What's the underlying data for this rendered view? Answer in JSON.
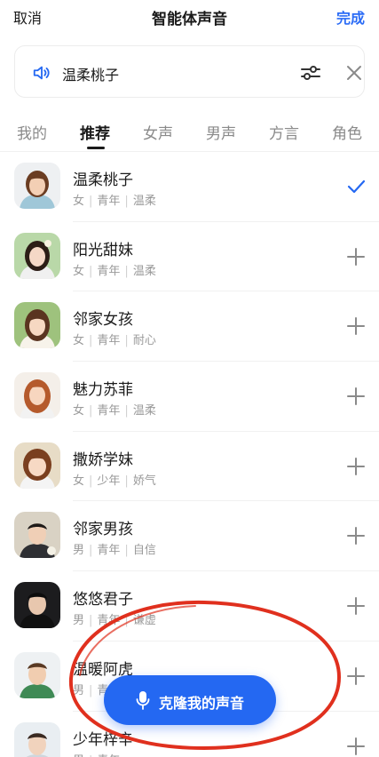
{
  "header": {
    "cancel_label": "取消",
    "title": "智能体声音",
    "done_label": "完成"
  },
  "selected_voice": {
    "name": "温柔桃子"
  },
  "tabs": [
    {
      "label": "我的",
      "active": false
    },
    {
      "label": "推荐",
      "active": true
    },
    {
      "label": "女声",
      "active": false
    },
    {
      "label": "男声",
      "active": false
    },
    {
      "label": "方言",
      "active": false
    },
    {
      "label": "角色",
      "active": false
    }
  ],
  "voices": [
    {
      "name": "温柔桃子",
      "gender": "女",
      "age": "青年",
      "style": "温柔",
      "selected": true
    },
    {
      "name": "阳光甜妹",
      "gender": "女",
      "age": "青年",
      "style": "温柔",
      "selected": false
    },
    {
      "name": "邻家女孩",
      "gender": "女",
      "age": "青年",
      "style": "耐心",
      "selected": false
    },
    {
      "name": "魅力苏菲",
      "gender": "女",
      "age": "青年",
      "style": "温柔",
      "selected": false
    },
    {
      "name": "撒娇学妹",
      "gender": "女",
      "age": "少年",
      "style": "娇气",
      "selected": false
    },
    {
      "name": "邻家男孩",
      "gender": "男",
      "age": "青年",
      "style": "自信",
      "selected": false
    },
    {
      "name": "悠悠君子",
      "gender": "男",
      "age": "青年",
      "style": "谦虚",
      "selected": false
    },
    {
      "name": "温暖阿虎",
      "gender": "男",
      "age": "青年",
      "style": "",
      "selected": false
    },
    {
      "name": "少年梓辛",
      "gender": "男",
      "age": "青年",
      "style": "",
      "selected": false
    }
  ],
  "clone_button": {
    "label": "克隆我的声音"
  },
  "colors": {
    "accent": "#2468f2",
    "annotation_red": "#e0301e"
  }
}
